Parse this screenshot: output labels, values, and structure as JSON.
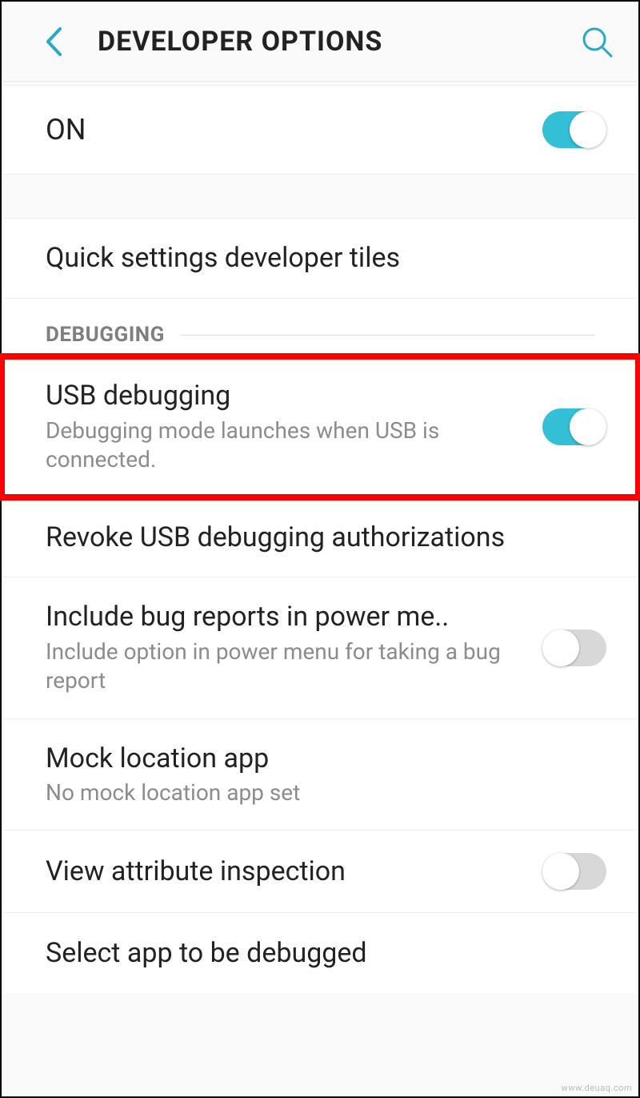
{
  "header": {
    "title": "DEVELOPER OPTIONS"
  },
  "masterToggle": {
    "label": "ON",
    "state": "on"
  },
  "section": {
    "quickTiles": "Quick settings developer tiles",
    "debuggingHeader": "DEBUGGING"
  },
  "items": {
    "usbDebugging": {
      "title": "USB debugging",
      "desc": "Debugging mode launches when USB is connected.",
      "state": "on"
    },
    "revoke": {
      "title": "Revoke USB debugging authorizations"
    },
    "bugReports": {
      "title": "Include bug reports in power me..",
      "desc": "Include option in power menu for taking a bug report",
      "state": "off"
    },
    "mockLocation": {
      "title": "Mock location app",
      "desc": "No mock location app set"
    },
    "viewAttr": {
      "title": "View attribute inspection",
      "state": "off"
    },
    "selectApp": {
      "title": "Select app to be debugged"
    }
  },
  "watermark": "www.deuaq.com"
}
